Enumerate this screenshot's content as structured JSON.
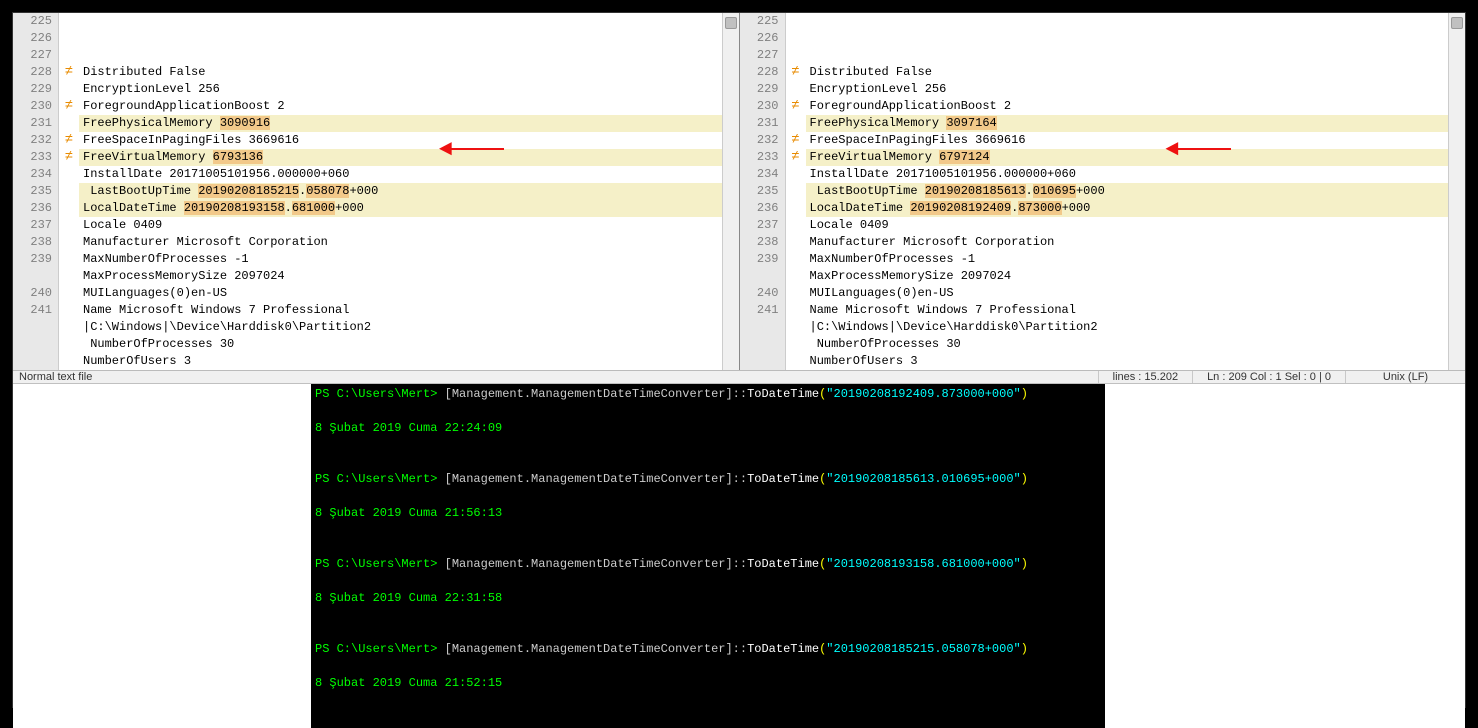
{
  "left": {
    "lines": [
      {
        "n": "225",
        "text": "Distributed False"
      },
      {
        "n": "226",
        "text": "EncryptionLevel 256"
      },
      {
        "n": "227",
        "text": "ForegroundApplicationBoost 2"
      },
      {
        "n": "228",
        "diff": true,
        "marker": true,
        "pre": "FreePhysicalMemory ",
        "hl": "3090916",
        "post": ""
      },
      {
        "n": "229",
        "text": "FreeSpaceInPagingFiles 3669616"
      },
      {
        "n": "230",
        "diff": true,
        "marker": true,
        "pre": "FreeVirtualMemory ",
        "hl": "6793136",
        "post": ""
      },
      {
        "n": "231",
        "text": "InstallDate 20171005101956.000000+060"
      },
      {
        "n": "232",
        "diff": true,
        "marker": true,
        "pre": " LastBootUpTime ",
        "hlO": "20190208185215",
        "dot": ".",
        "hl2": "058078",
        "post": "+000"
      },
      {
        "n": "233",
        "diff": true,
        "marker": true,
        "pre": "LocalDateTime ",
        "hlO": "20190208193158",
        "dot": ".",
        "hl2": "681000",
        "post": "+000"
      },
      {
        "n": "234",
        "text": "Locale 0409"
      },
      {
        "n": "235",
        "text": "Manufacturer Microsoft Corporation"
      },
      {
        "n": "236",
        "text": "MaxNumberOfProcesses -1"
      },
      {
        "n": "237",
        "text": "MaxProcessMemorySize 2097024"
      },
      {
        "n": "238",
        "text": "MUILanguages(0)en-US"
      },
      {
        "n": "239",
        "text": "Name Microsoft Windows 7 Professional"
      },
      {
        "n": "",
        "text": "|C:\\Windows|\\Device\\Harddisk0\\Partition2"
      },
      {
        "n": "240",
        "text": " NumberOfProcesses 30"
      },
      {
        "n": "241",
        "text": "NumberOfUsers 3"
      }
    ]
  },
  "right": {
    "lines": [
      {
        "n": "225",
        "text": "Distributed False"
      },
      {
        "n": "226",
        "text": "EncryptionLevel 256"
      },
      {
        "n": "227",
        "text": "ForegroundApplicationBoost 2"
      },
      {
        "n": "228",
        "diff": true,
        "marker": true,
        "pre": "FreePhysicalMemory ",
        "hl": "3097164",
        "post": ""
      },
      {
        "n": "229",
        "text": "FreeSpaceInPagingFiles 3669616"
      },
      {
        "n": "230",
        "diff": true,
        "marker": true,
        "pre": "FreeVirtualMemory ",
        "hl": "6797124",
        "post": ""
      },
      {
        "n": "231",
        "text": "InstallDate 20171005101956.000000+060"
      },
      {
        "n": "232",
        "diff": true,
        "marker": true,
        "pre": " LastBootUpTime ",
        "hlO": "20190208185613",
        "dot": ".",
        "hl2": "010695",
        "post": "+000"
      },
      {
        "n": "233",
        "diff": true,
        "marker": true,
        "pre": "LocalDateTime ",
        "hlO": "20190208192409",
        "dot": ".",
        "hl2": "873000",
        "post": "+000"
      },
      {
        "n": "234",
        "text": "Locale 0409"
      },
      {
        "n": "235",
        "text": "Manufacturer Microsoft Corporation"
      },
      {
        "n": "236",
        "text": "MaxNumberOfProcesses -1"
      },
      {
        "n": "237",
        "text": "MaxProcessMemorySize 2097024"
      },
      {
        "n": "238",
        "text": "MUILanguages(0)en-US"
      },
      {
        "n": "239",
        "text": "Name Microsoft Windows 7 Professional"
      },
      {
        "n": "",
        "text": "|C:\\Windows|\\Device\\Harddisk0\\Partition2"
      },
      {
        "n": "240",
        "text": " NumberOfProcesses 30"
      },
      {
        "n": "241",
        "text": "NumberOfUsers 3"
      }
    ]
  },
  "status": {
    "left": "Normal text file",
    "lines": "lines : 15.202",
    "pos": "Ln : 209   Col : 1   Sel : 0 | 0",
    "eol": "Unix (LF)"
  },
  "terminal": {
    "prompt": "PS C:\\Users\\Mert>",
    "cls": "[Management.ManagementDateTimeConverter]",
    "sep": "::",
    "fn": "ToDateTime",
    "open": "(",
    "close": ")",
    "args": [
      "\"20190208192409.873000+000\"",
      "\"20190208185613.010695+000\"",
      "\"20190208193158.681000+000\"",
      "\"20190208185215.058078+000\""
    ],
    "outs": [
      "8 Şubat 2019 Cuma 22:24:09",
      "8 Şubat 2019 Cuma 21:56:13",
      "8 Şubat 2019 Cuma 22:31:58",
      "8 Şubat 2019 Cuma 21:52:15"
    ]
  }
}
